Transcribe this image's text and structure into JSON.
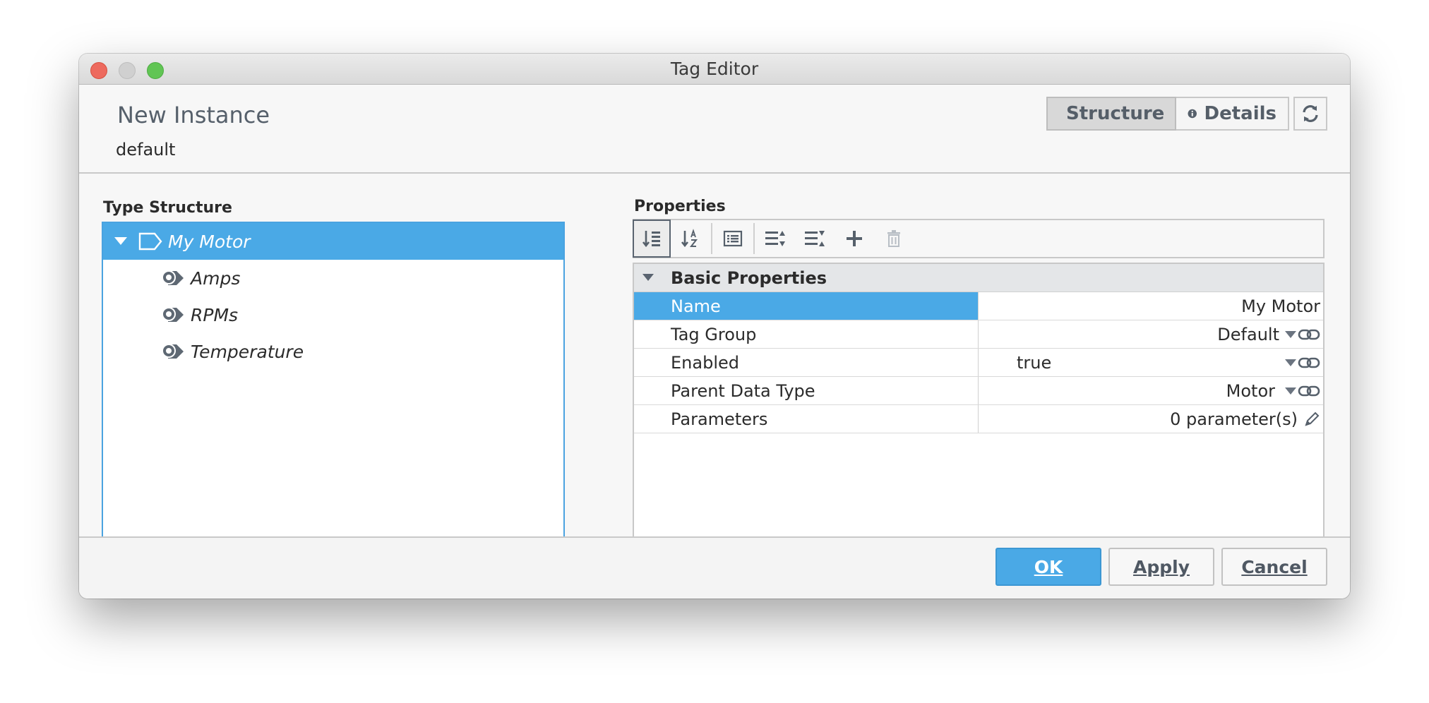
{
  "window": {
    "title": "Tag Editor"
  },
  "header": {
    "title": "New Instance",
    "subtitle": "default",
    "segments": [
      {
        "label": "Structure",
        "icon": "tag-icon",
        "active": true
      },
      {
        "label": "Details",
        "icon": "info-icon",
        "active": false
      }
    ],
    "refresh_icon": "refresh-icon"
  },
  "type_structure": {
    "label": "Type Structure",
    "root": {
      "label": "My Motor",
      "icon": "udt-instance-icon",
      "expanded": true,
      "selected": true
    },
    "children": [
      {
        "label": "Amps",
        "icon": "opc-tag-icon"
      },
      {
        "label": "RPMs",
        "icon": "opc-tag-icon"
      },
      {
        "label": "Temperature",
        "icon": "opc-tag-icon"
      }
    ]
  },
  "properties": {
    "label": "Properties",
    "toolbar": [
      {
        "icon": "sort-categorized-icon",
        "pressed": true
      },
      {
        "icon": "sort-alphabetical-icon",
        "pressed": false
      },
      {
        "icon": "show-description-icon",
        "pressed": false
      },
      {
        "icon": "expand-all-icon",
        "pressed": false
      },
      {
        "icon": "collapse-all-icon",
        "pressed": false
      },
      {
        "icon": "add-icon",
        "pressed": false
      },
      {
        "icon": "delete-icon",
        "pressed": false,
        "disabled": true
      }
    ],
    "group": "Basic Properties",
    "rows": [
      {
        "name": "Name",
        "value": "My Motor",
        "selected": true
      },
      {
        "name": "Tag Group",
        "value": "Default"
      },
      {
        "name": "Enabled",
        "value": "true"
      },
      {
        "name": "Parent Data Type",
        "value": "Motor"
      },
      {
        "name": "Parameters",
        "value": "0 parameter(s)"
      }
    ]
  },
  "footer": {
    "ok_label": "OK",
    "apply_label": "Apply",
    "cancel_label": "Cancel"
  },
  "colors": {
    "accent": "#4aa9e6",
    "close": "#ed6a5e",
    "maximize": "#61c554"
  }
}
